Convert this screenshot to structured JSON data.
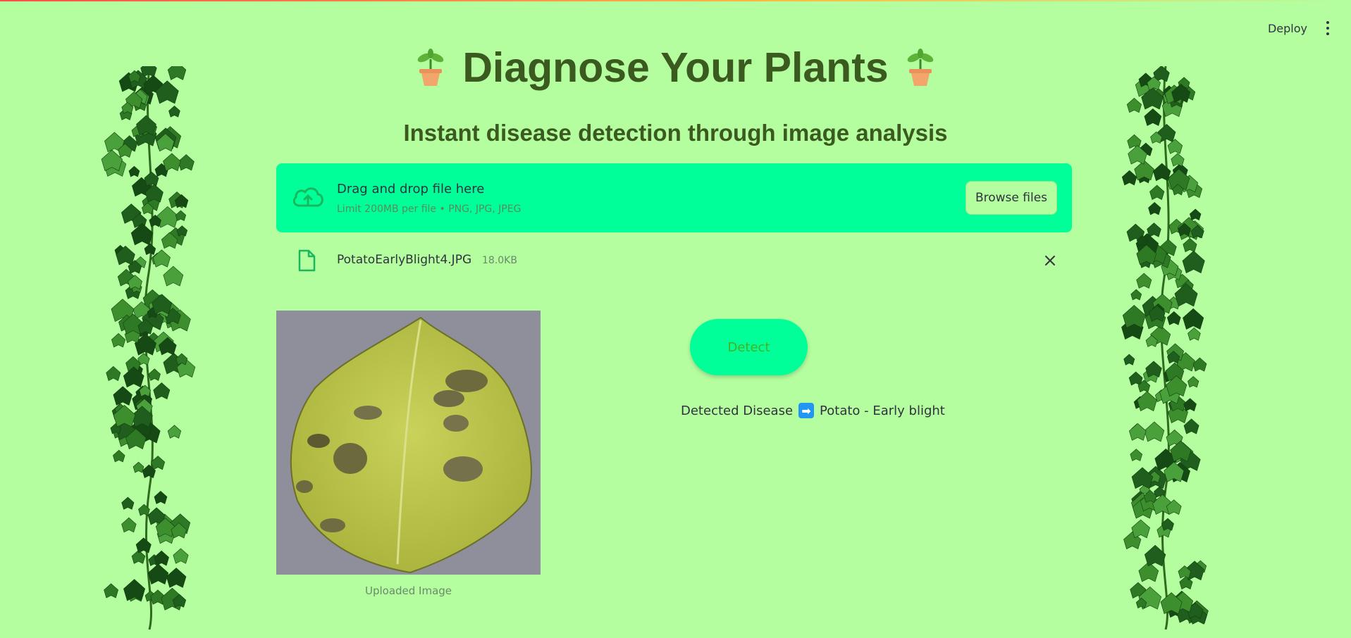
{
  "header": {
    "deploy_label": "Deploy",
    "menu_icon": "kebab-menu-icon"
  },
  "page": {
    "title": "Diagnose Your Plants",
    "subtitle": "Instant disease detection through image analysis",
    "title_icon": "potted-plant-icon"
  },
  "uploader": {
    "drop_title": "Drag and drop file here",
    "drop_limit": "Limit 200MB per file • PNG, JPG, JPEG",
    "browse_label": "Browse files",
    "icon": "cloud-upload-icon"
  },
  "file": {
    "name": "PotatoEarlyBlight4.JPG",
    "size": "18.0KB",
    "icon": "file-icon"
  },
  "image": {
    "caption": "Uploaded Image"
  },
  "detect": {
    "label": "Detect",
    "result_label": "Detected Disease",
    "result_value": "Potato - Early blight",
    "arrow_glyph": "➡"
  },
  "colors": {
    "background": "#b4fe9f",
    "accent": "#00ff99",
    "title": "#3a5a1f",
    "button_text": "#4caf1e"
  }
}
